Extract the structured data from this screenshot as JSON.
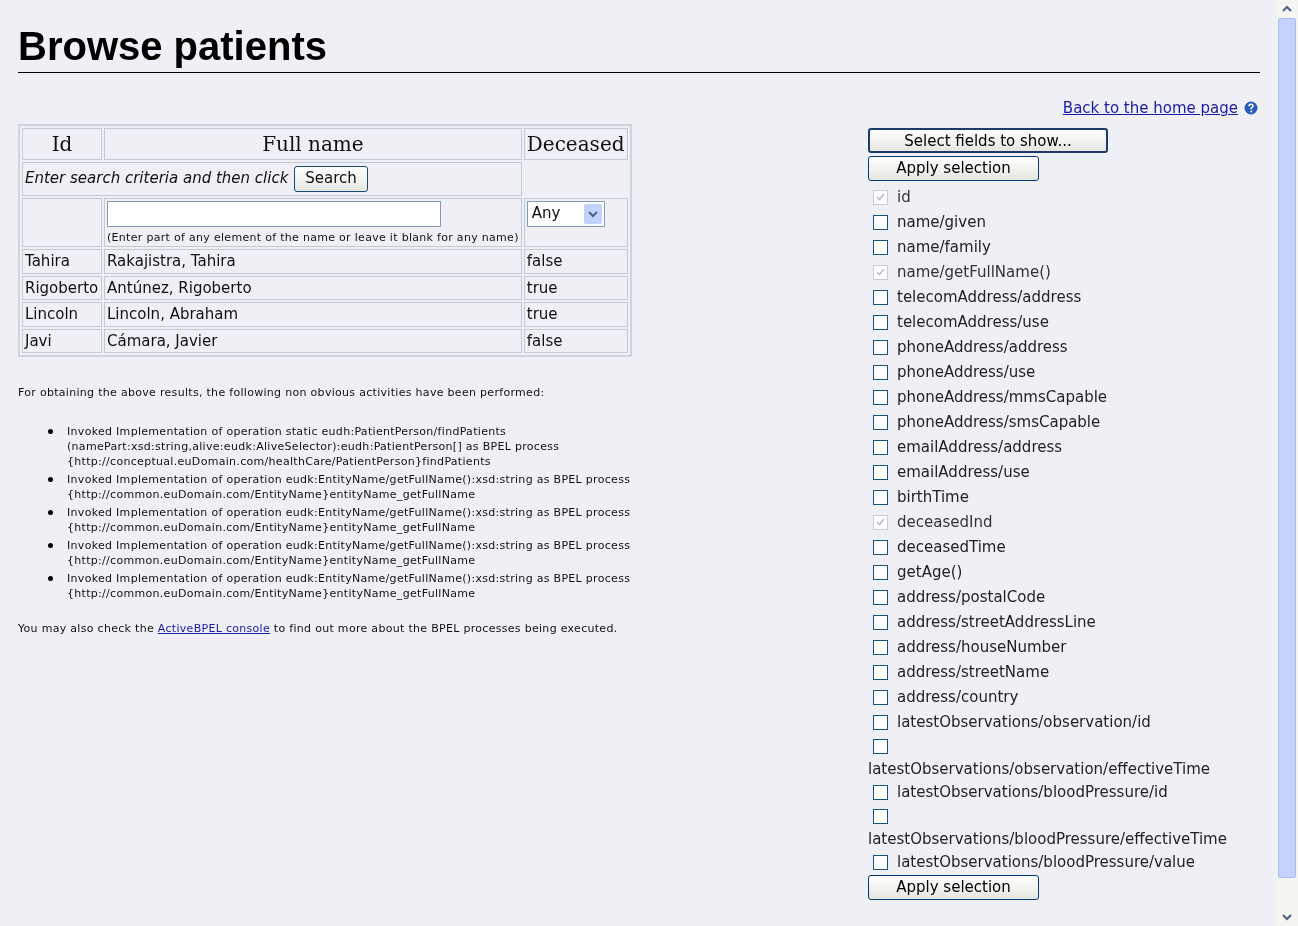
{
  "title": "Browse patients",
  "home_link": "Back to the home page",
  "table": {
    "columns": [
      "Id",
      "Full name",
      "Deceased"
    ],
    "search_prompt": "Enter search criteria and then click",
    "search_button": "Search",
    "name_hint": "(Enter part of any element of the name or leave it blank for any name)",
    "deceased_filter": "Any",
    "rows": [
      {
        "id": "Tahira",
        "full_name": "Rakajistra, Tahira",
        "deceased": "false"
      },
      {
        "id": "Rigoberto",
        "full_name": "Antúnez, Rigoberto",
        "deceased": "true"
      },
      {
        "id": "Lincoln",
        "full_name": "Lincoln, Abraham",
        "deceased": "true"
      },
      {
        "id": "Javi",
        "full_name": "Cámara, Javier",
        "deceased": "false"
      }
    ]
  },
  "activities_intro": "For obtaining the above results, the following non obvious activities have been performed:",
  "activities": [
    "Invoked Implementation of operation static eudh:PatientPerson/findPatients\n(namePart:xsd:string,alive:eudk:AliveSelector):eudh:PatientPerson[] as BPEL process\n{http://conceptual.euDomain.com/healthCare/PatientPerson}findPatients",
    "Invoked Implementation of operation eudk:EntityName/getFullName():xsd:string as BPEL process\n{http://common.euDomain.com/EntityName}entityName_getFullName",
    "Invoked Implementation of operation eudk:EntityName/getFullName():xsd:string as BPEL process\n{http://common.euDomain.com/EntityName}entityName_getFullName",
    "Invoked Implementation of operation eudk:EntityName/getFullName():xsd:string as BPEL process\n{http://common.euDomain.com/EntityName}entityName_getFullName",
    "Invoked Implementation of operation eudk:EntityName/getFullName():xsd:string as BPEL process\n{http://common.euDomain.com/EntityName}entityName_getFullName"
  ],
  "console_note": {
    "before": "You may also check the",
    "link": "ActiveBPEL console",
    "after": "to find out more about the BPEL processes being executed."
  },
  "fields_panel": {
    "select_button": "Select fields to show...",
    "apply_button_top": "Apply selection",
    "apply_button_bottom": "Apply selection",
    "fields": [
      {
        "label": "id",
        "checked": true,
        "disabled": true,
        "kind": "inline"
      },
      {
        "label": "name/given",
        "checked": false,
        "disabled": false,
        "kind": "inline"
      },
      {
        "label": "name/family",
        "checked": false,
        "disabled": false,
        "kind": "inline"
      },
      {
        "label": "name/getFullName()",
        "checked": true,
        "disabled": true,
        "kind": "inline"
      },
      {
        "label": "telecomAddress/address",
        "checked": false,
        "disabled": false,
        "kind": "inline"
      },
      {
        "label": "telecomAddress/use",
        "checked": false,
        "disabled": false,
        "kind": "inline"
      },
      {
        "label": "phoneAddress/address",
        "checked": false,
        "disabled": false,
        "kind": "inline"
      },
      {
        "label": "phoneAddress/use",
        "checked": false,
        "disabled": false,
        "kind": "inline"
      },
      {
        "label": "phoneAddress/mmsCapable",
        "checked": false,
        "disabled": false,
        "kind": "inline"
      },
      {
        "label": "phoneAddress/smsCapable",
        "checked": false,
        "disabled": false,
        "kind": "inline"
      },
      {
        "label": "emailAddress/address",
        "checked": false,
        "disabled": false,
        "kind": "inline"
      },
      {
        "label": "emailAddress/use",
        "checked": false,
        "disabled": false,
        "kind": "inline"
      },
      {
        "label": "birthTime",
        "checked": false,
        "disabled": false,
        "kind": "inline"
      },
      {
        "label": "deceasedInd",
        "checked": true,
        "disabled": true,
        "kind": "inline"
      },
      {
        "label": "deceasedTime",
        "checked": false,
        "disabled": false,
        "kind": "inline"
      },
      {
        "label": "getAge()",
        "checked": false,
        "disabled": false,
        "kind": "inline"
      },
      {
        "label": "address/postalCode",
        "checked": false,
        "disabled": false,
        "kind": "inline"
      },
      {
        "label": "address/streetAddressLine",
        "checked": false,
        "disabled": false,
        "kind": "inline"
      },
      {
        "label": "address/houseNumber",
        "checked": false,
        "disabled": false,
        "kind": "inline"
      },
      {
        "label": "address/streetName",
        "checked": false,
        "disabled": false,
        "kind": "inline"
      },
      {
        "label": "address/country",
        "checked": false,
        "disabled": false,
        "kind": "inline"
      },
      {
        "label": "latestObservations/observation/id",
        "checked": false,
        "disabled": false,
        "kind": "inline"
      },
      {
        "label": "latestObservations/observation/effectiveTime",
        "checked": false,
        "disabled": false,
        "kind": "wrapped"
      },
      {
        "label": "latestObservations/bloodPressure/id",
        "checked": false,
        "disabled": false,
        "kind": "inline"
      },
      {
        "label": "latestObservations/bloodPressure/effectiveTime",
        "checked": false,
        "disabled": false,
        "kind": "wrapped"
      },
      {
        "label": "latestObservations/bloodPressure/value",
        "checked": false,
        "disabled": false,
        "kind": "inline"
      }
    ]
  }
}
